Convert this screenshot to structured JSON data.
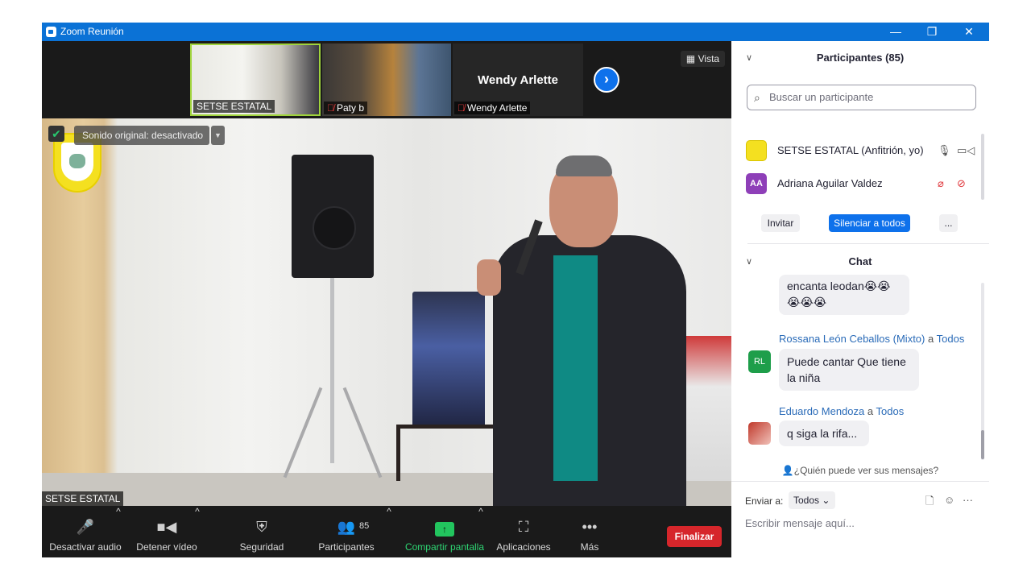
{
  "window": {
    "title": "Zoom Reunión",
    "controls": [
      "—",
      "❐",
      "✕"
    ]
  },
  "video": {
    "view_label": "Vista",
    "thumbnails": [
      {
        "name": "SETSE ESTATAL",
        "muted": false
      },
      {
        "name": "Paty b",
        "muted": true
      },
      {
        "name": "Wendy  Arlette",
        "muted": true,
        "big_name": "Wendy  Arlette"
      }
    ],
    "original_sound": "Sonido original: desactivado",
    "main_speaker_label": "SETSE ESTATAL"
  },
  "toolbar": {
    "audio": "Desactivar audio",
    "video": "Detener vídeo",
    "security": "Seguridad",
    "participants": "Participantes",
    "participants_count": "85",
    "share": "Compartir pantalla",
    "apps": "Aplicaciones",
    "more": "Más",
    "end": "Finalizar"
  },
  "participants_panel": {
    "title": "Participantes (85)",
    "search_placeholder": "Buscar un participante",
    "list": [
      {
        "name": "SETSE ESTATAL (Anfitrión, yo)",
        "initials": "",
        "avatar_color": "#f4e020"
      },
      {
        "name": "Adriana Aguilar Valdez",
        "initials": "AA",
        "avatar_color": "#8e3fb8"
      }
    ],
    "invite": "Invitar",
    "mute_all": "Silenciar a todos",
    "more": "..."
  },
  "chat_panel": {
    "title": "Chat",
    "messages": [
      {
        "sender": "",
        "to": "",
        "text_line1": "encanta leodan😭😭",
        "text_line2": "😭😭😭"
      },
      {
        "sender": "Rossana León Ceballos (Mixto)",
        "to_word": "a",
        "to": "Todos",
        "initials": "RL",
        "avatar_color": "#1e9e4a",
        "text_line1": "Puede cantar Que tiene",
        "text_line2": "la niña"
      },
      {
        "sender": "Eduardo Mendoza",
        "to_word": "a",
        "to": "Todos",
        "initials": "",
        "avatar_color": "#c0392b",
        "text_line1": "q siga la rifa...",
        "text_line2": ""
      }
    ],
    "who_can_see": "¿Quién puede ver sus mensajes?",
    "send_to_label": "Enviar a:",
    "send_to_value": "Todos",
    "input_placeholder": "Escribir mensaje aquí..."
  }
}
